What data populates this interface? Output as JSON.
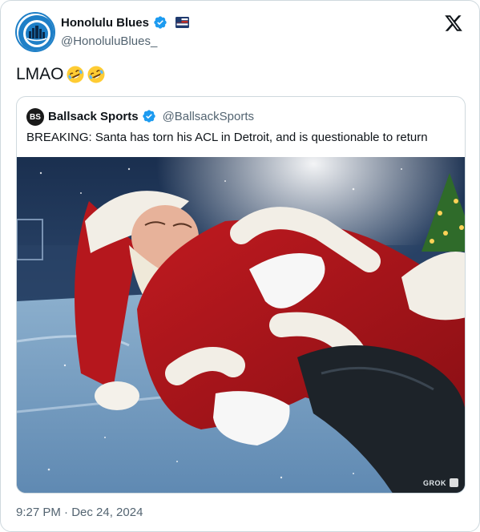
{
  "author": {
    "display_name": "Honolulu Blues",
    "handle": "@HonoluluBlues_",
    "avatar_icon": "honolulu-blues-logo",
    "verified": true
  },
  "tweet": {
    "text": "LMAO",
    "emoji": [
      "rolling-on-floor-laughing",
      "rolling-on-floor-laughing"
    ],
    "timestamp": "9:27 PM · Dec 24, 2024"
  },
  "quote": {
    "display_name": "Ballsack Sports",
    "handle": "@BallsackSports",
    "avatar_text": "BS",
    "verified": true,
    "text": "BREAKING: Santa has torn his ACL in Detroit, and is questionable to return",
    "media_watermark": "GROK"
  },
  "colors": {
    "verified_blue": "#1d9bf0",
    "secondary_text": "#536471",
    "border": "#cfd9de"
  }
}
